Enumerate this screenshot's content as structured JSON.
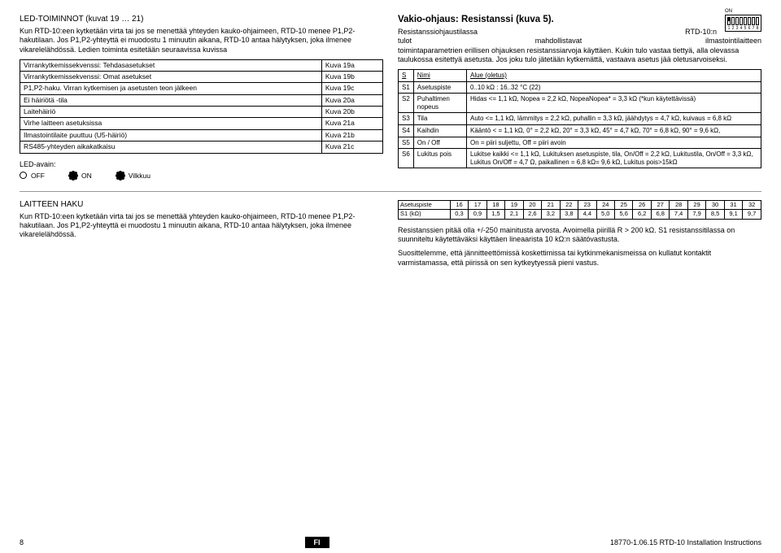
{
  "left": {
    "heading": "LED-TOIMINNOT (kuvat 19 … 21)",
    "p1": "Kun RTD-10:een kytketään virta tai jos se menettää yhteyden kauko-ohjaimeen, RTD-10 menee P1,P2-hakutilaan. Jos P1,P2-yhteyttä ei muodostu 1 minuutin aikana, RTD-10 antaa hälytyksen, joka ilmenee vikarelelähdössä. Ledien toiminta esitetään seuraavissa kuvissa",
    "rows": [
      [
        "Virrankytkemissekvenssi: Tehdasasetukset",
        "Kuva 19a"
      ],
      [
        "Virrankytkemissekvenssi: Omat asetukset",
        "Kuva 19b"
      ],
      [
        "P1,P2-haku. Virran kytkemisen ja asetusten teon jälkeen",
        "Kuva 19c"
      ],
      [
        "Ei häiriötä -tila",
        "Kuva 20a"
      ],
      [
        "Laitehäiriö",
        "Kuva 20b"
      ],
      [
        "Virhe laitteen asetuksissa",
        "Kuva 21a"
      ],
      [
        "Ilmastointilaite puuttuu (U5-häiriö)",
        "Kuva 21b"
      ],
      [
        "RS485-yhteyden aikakatkaisu",
        "Kuva 21c"
      ]
    ],
    "ledKey": "LED-avain:",
    "off": "OFF",
    "on": "ON",
    "blink": "Vilkkuu"
  },
  "right": {
    "title": "Vakio-ohjaus: Resistanssi (kuva 5).",
    "dipOn": "ON",
    "dipNums": [
      "1",
      "2",
      "3",
      "4",
      "5",
      "6",
      "7",
      "8"
    ],
    "p1a": "Resistanssiohjaustilassa",
    "p1b": "RTD-10:n",
    "p1c": "tulot",
    "p1d": "mahdollistavat",
    "p1e": "ilmastointilaitteen",
    "p2": "toimintaparametrien erillisen ohjauksen resistanssiarvoja käyttäen. Kukin tulo vastaa tiettyä, alla olevassa taulukossa esitettyä asetusta. Jos joku tulo jätetään kytkemättä, vastaava asetus jää oletusarvoiseksi.",
    "th": [
      "S",
      "Nimi",
      "Alue (oletus)"
    ],
    "rows": [
      [
        "S1",
        "Asetuspiste",
        "0..10 kΩ : 16..32 °C (22)"
      ],
      [
        "S2",
        "Puhaltimen nopeus",
        "Hidas <= 1,1 kΩ, Nopea = 2,2 kΩ, NopeaNopea* = 3,3 kΩ (*kun käytettävissä)"
      ],
      [
        "S3",
        "Tila",
        "Auto <= 1,1 kΩ, lämmitys = 2,2 kΩ, puhallin = 3,3 kΩ, jäähdytys = 4,7 kΩ, kuivaus = 6,8 kΩ"
      ],
      [
        "S4",
        "Kaihdin",
        "Kääntö < = 1,1 kΩ, 0° = 2,2 kΩ, 20° = 3,3 kΩ, 45° = 4,7 kΩ, 70° = 6,8 kΩ, 90° = 9,6 kΩ,"
      ],
      [
        "S5",
        "On / Off",
        "On = piiri suljettu, Off = piiri avoin"
      ],
      [
        "S6",
        "Lukitus pois",
        "Lukitse kaikki <= 1,1 kΩ, Lukituksen asetuspiste, tila, On/Off = 2,2 kΩ, Lukitustila, On/Off = 3,3 kΩ, Lukitus On/Off = 4,7 Ω, paikallinen = 6,8 kΩ= 9,6 kΩ, Lukitus pois>15kΩ"
      ]
    ]
  },
  "bottom": {
    "left": {
      "heading": "LAITTEEN HAKU",
      "p": "Kun RTD-10:een kytketään virta tai jos se menettää yhteyden kauko-ohjaimeen, RTD-10 menee P1,P2-hakutilaan. Jos P1,P2-yhteyttä ei muodostu 1 minuutin aikana, RTD-10 antaa hälytyksen, joka ilmenee vikarelelähdössä."
    },
    "right": {
      "row1": [
        "Asetuspiste",
        "16",
        "17",
        "18",
        "19",
        "20",
        "21",
        "22",
        "23",
        "24",
        "25",
        "26",
        "27",
        "28",
        "29",
        "30",
        "31",
        "32"
      ],
      "row2": [
        "S1 (kΩ)",
        "0,3",
        "0,9",
        "1,5",
        "2,1",
        "2,6",
        "3,2",
        "3,8",
        "4,4",
        "5,0",
        "5,6",
        "6,2",
        "6,8",
        "7,4",
        "7,9",
        "8,5",
        "9,1",
        "9,7"
      ],
      "p1": "Resistanssien pitää olla +/-250 mainitusta arvosta. Avoimella piirillä R > 200 kΩ. S1 resistanssitilassa on suunniteltu käytettäväksi käyttäen lineaarista 10 kΩ:n säätövastusta.",
      "p2": "Suosittelemme, että jännitteettömissä koskettimissa tai kytkinmekanismeissa on kullatut kontaktit varmistamassa, että piirissä on sen kytkeytyessä pieni vastus."
    }
  },
  "footer": {
    "pg": "8",
    "lang": "FI",
    "doc": "18770-1.06.15 RTD-10 Installation Instructions"
  }
}
